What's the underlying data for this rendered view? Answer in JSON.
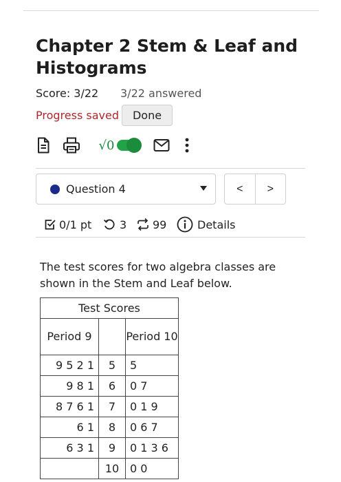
{
  "header": {
    "title": "Chapter 2 Stem & Leaf and Histograms",
    "score": "Score: 3/22",
    "answered": "3/22 answered",
    "progress_status": "Progress saved",
    "done_label": "Done"
  },
  "toolbar": {
    "icons": [
      "document-icon",
      "print-icon",
      "sqrt-icon",
      "toggle-switch",
      "mail-icon",
      "more-icon"
    ],
    "sqrt_label": "√0",
    "toggle_on": true
  },
  "question_nav": {
    "selected": "Question 4",
    "prev_label": "<",
    "next_label": ">"
  },
  "meta": {
    "points": "0/1 pt",
    "attempts": "3",
    "submissions": "99",
    "details_label": "Details"
  },
  "question": {
    "text": "The test scores for two algebra classes are shown in the Stem and Leaf below."
  },
  "table": {
    "caption": "Test Scores",
    "left_header": "Period 9",
    "right_header": "Period 10",
    "rows": [
      {
        "left": "9 5 2 1",
        "stem": "5",
        "right": "5"
      },
      {
        "left": "9 8 1",
        "stem": "6",
        "right": "0 7"
      },
      {
        "left": "8 7 6 1",
        "stem": "7",
        "right": "0 1 9"
      },
      {
        "left": "6 1",
        "stem": "8",
        "right": "0 6 7"
      },
      {
        "left": "6 3 1",
        "stem": "9",
        "right": "0 1 3 6"
      },
      {
        "left": "",
        "stem": "10",
        "right": "0 0"
      }
    ]
  },
  "colors": {
    "progress_saved": "#b0262b",
    "accent_green": "#1b8c3c",
    "question_dot": "#1c2a8c"
  }
}
